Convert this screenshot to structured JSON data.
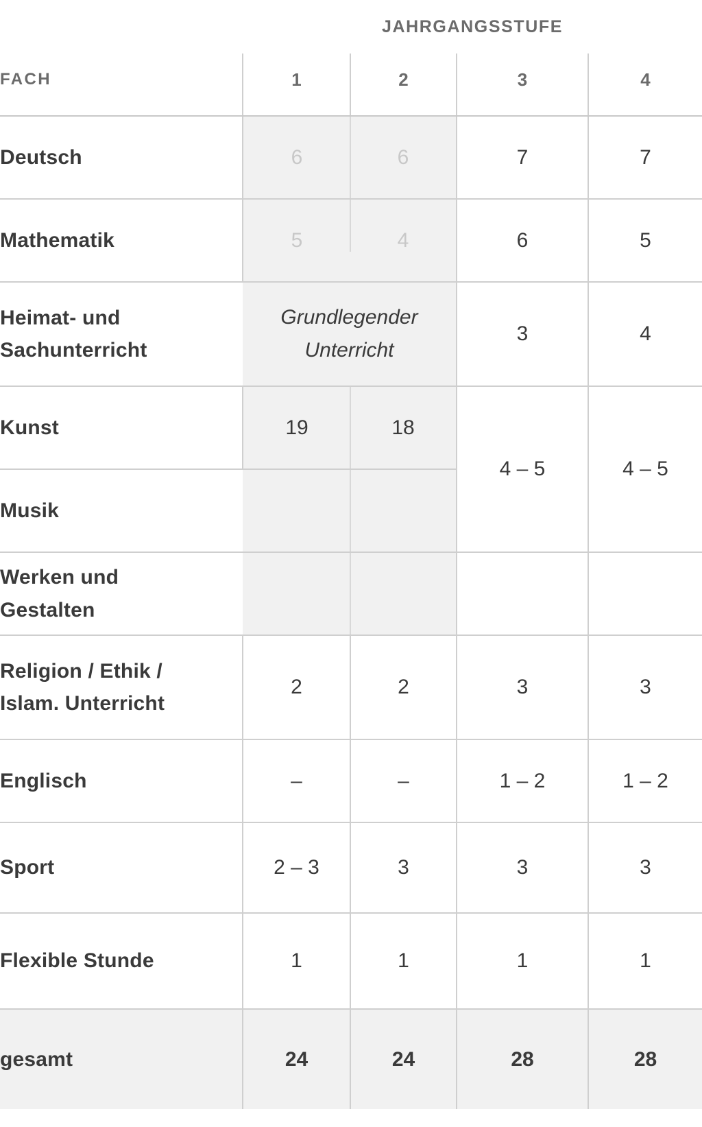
{
  "table": {
    "group_header": "JAHRGANGSSTUFE",
    "subject_header": "FACH",
    "year_columns": [
      "1",
      "2",
      "3",
      "4"
    ],
    "span_label": "Grundlegender Unterricht",
    "rows": [
      {
        "subject": "Deutsch",
        "y1": "6",
        "y2": "6",
        "y3": "7",
        "y4": "7"
      },
      {
        "subject": "Mathematik",
        "y1": "5",
        "y2": "4",
        "y3": "6",
        "y4": "5"
      },
      {
        "subject": "Heimat- und Sachunterricht",
        "subject_line1": "Heimat- und",
        "subject_line2": "Sachunterricht",
        "y1": "",
        "y2": "",
        "y3": "3",
        "y4": "4"
      },
      {
        "subject": "Kunst",
        "y1": "19",
        "y2": "18",
        "y3": "",
        "y4": ""
      },
      {
        "subject": "Musik",
        "y1": "",
        "y2": "",
        "y3": "4 – 5",
        "y4": "4 – 5"
      },
      {
        "subject": "Werken und Gestalten",
        "subject_line1": "Werken und",
        "subject_line2": "Gestalten",
        "y1": "",
        "y2": "",
        "y3": "",
        "y4": ""
      },
      {
        "subject": "Religion / Ethik / Islam. Unterricht",
        "subject_line1": "Religion / Ethik /",
        "subject_line2": "Islam. Unterricht",
        "y1": "2",
        "y2": "2",
        "y3": "3",
        "y4": "3"
      },
      {
        "subject": "Englisch",
        "y1": "–",
        "y2": "–",
        "y3": "1 – 2",
        "y4": "1 – 2"
      },
      {
        "subject": "Sport",
        "y1": "2 – 3",
        "y2": "3",
        "y3": "3",
        "y4": "3"
      },
      {
        "subject": "Flexible Stunde",
        "y1": "1",
        "y2": "1",
        "y3": "1",
        "y4": "1"
      }
    ],
    "total_row": {
      "subject": "gesamt",
      "y1": "24",
      "y2": "24",
      "y3": "28",
      "y4": "28"
    }
  }
}
